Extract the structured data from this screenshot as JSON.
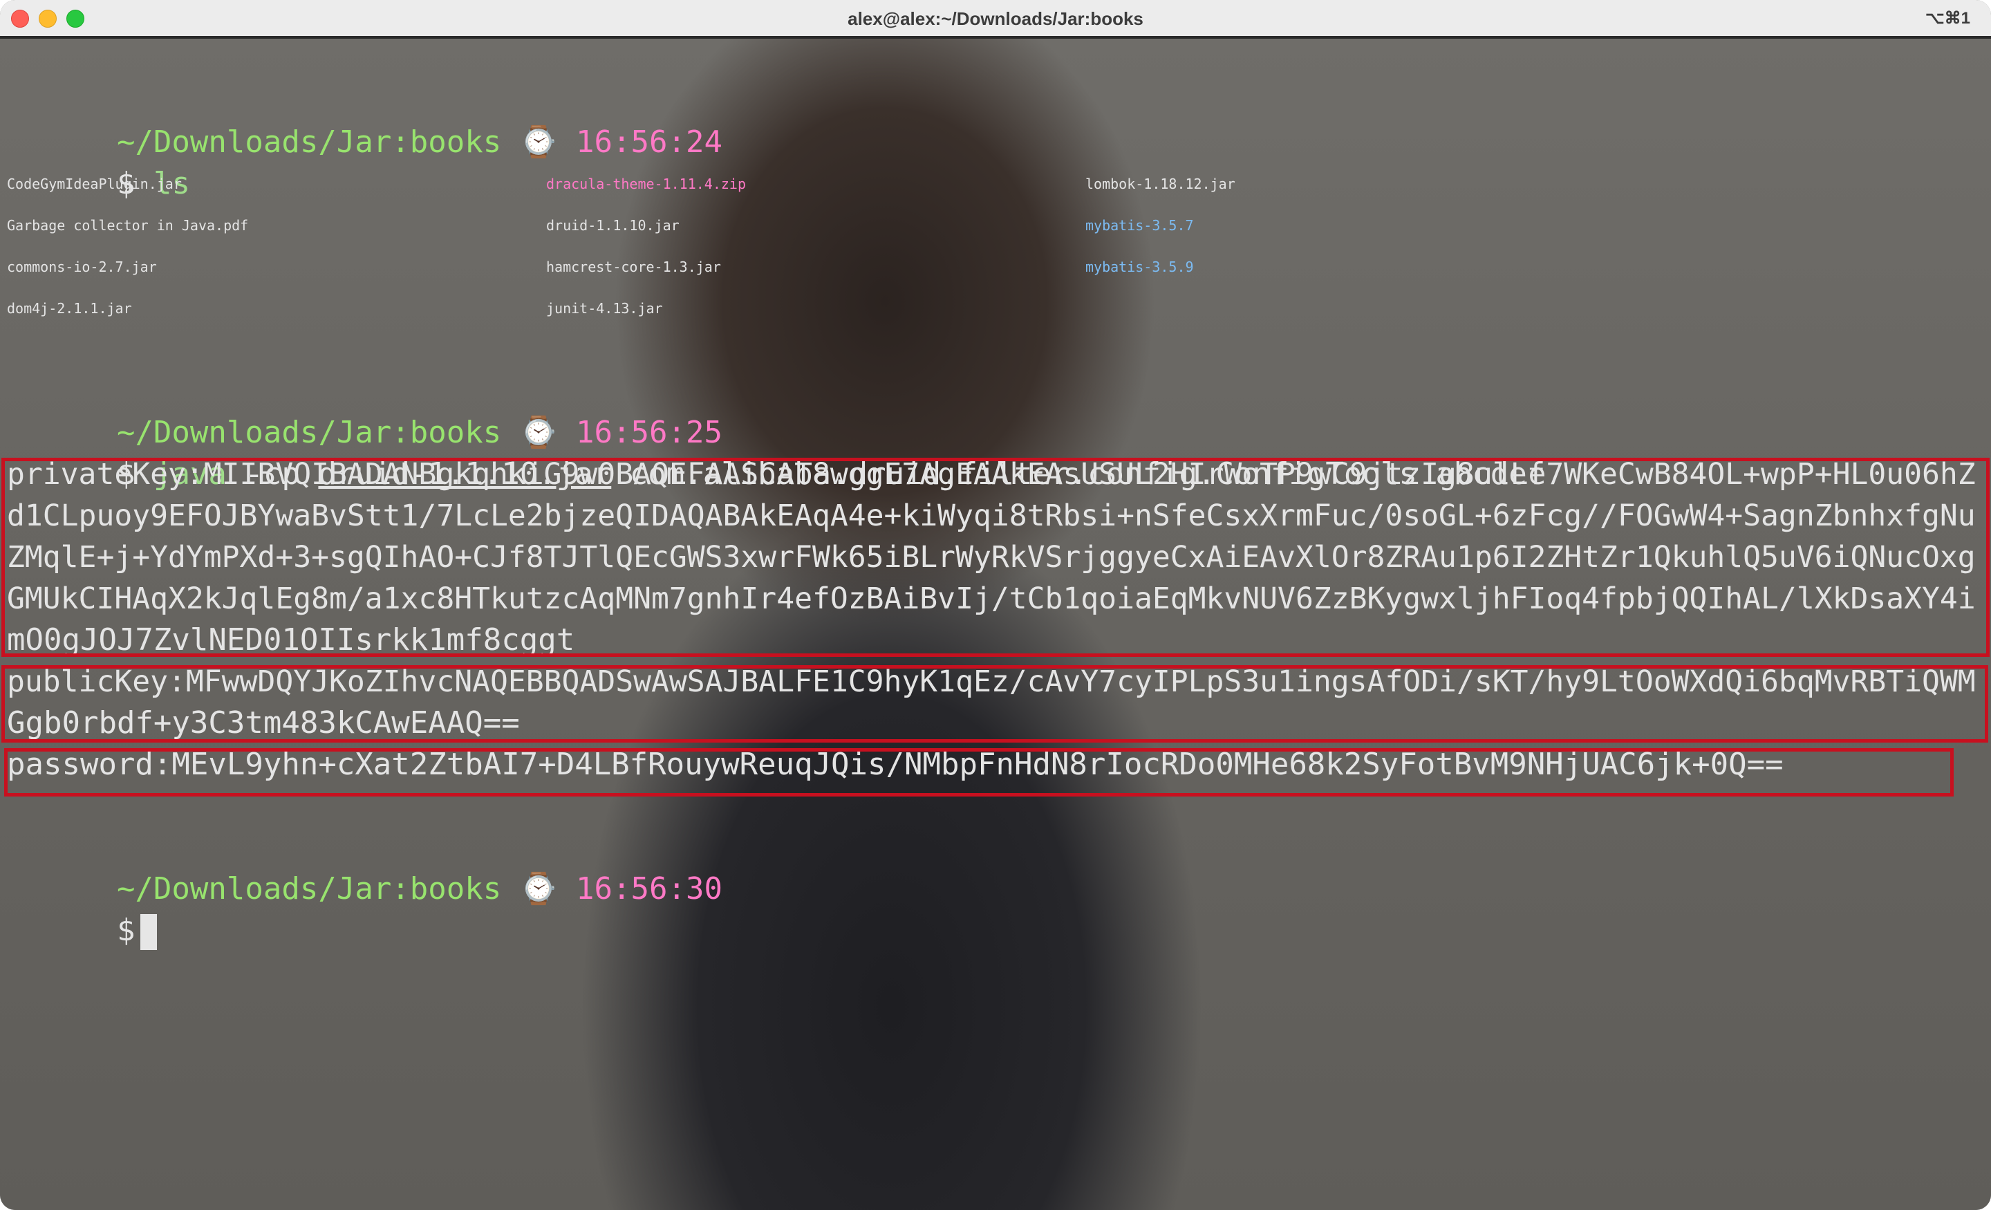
{
  "window": {
    "title": "alex@alex:~/Downloads/Jar:books",
    "shortcut": "⌥⌘1"
  },
  "prompts": [
    {
      "path": "~/Downloads/Jar:books",
      "icon": "⌚",
      "time": "16:56:24",
      "symbol": "$",
      "command": "ls"
    },
    {
      "path": "~/Downloads/Jar:books",
      "icon": "⌚",
      "time": "16:56:25",
      "symbol": "$",
      "command_name": "java",
      "command_flag": "-cp",
      "command_arg_jar": "druid-1.1.10.jar",
      "command_rest": "com.alibaba.druid.filter.config.ConfigTools abcdef"
    },
    {
      "path": "~/Downloads/Jar:books",
      "icon": "⌚",
      "time": "16:56:30",
      "symbol": "$"
    }
  ],
  "ls_output": {
    "rows": [
      [
        "CodeGymIdeaPlugin.jar",
        "dracula-theme-1.11.4.zip",
        "lombok-1.18.12.jar"
      ],
      [
        "Garbage collector in Java.pdf",
        "druid-1.1.10.jar",
        "mybatis-3.5.7"
      ],
      [
        "commons-io-2.7.jar",
        "hamcrest-core-1.3.jar",
        "mybatis-3.5.9"
      ],
      [
        "dom4j-2.1.1.jar",
        "junit-4.13.jar",
        ""
      ]
    ],
    "colors": {
      "archive": "#ff79c6",
      "directory": "#7cbbf2",
      "file": "#e4e4e4"
    }
  },
  "output": {
    "private_key_lines": [
      "privateKey:MIIBVQIBADANBgkqhkiG9w0BAQEFAASCAT8wggE7AgEAAkEAsUSUL2HIrWoTP9wC9jtzIg8ulLe7WKeCwB84OL+wpP+HL0u06hZ",
      "d1CLpuoy9EFOJBYwaBvStt1/7LcLe2bjzeQIDAQABAkEAqA4e+kiWyqi8tRbsi+nSfeCsxXrmFuc/0soGL+6zFcg//FOGwW4+SagnZbnhxfgNu",
      "ZMqlE+j+YdYmPXd+3+sgQIhAO+CJf8TJTlQEcGWS3xwrFWk65iBLrWyRkVSrjggyeCxAiEAvXlOr8ZRAu1p6I2ZHtZr1QkuhlQ5uV6iQNucOxg",
      "GMUkCIHAqX2kJqlEg8m/a1xc8HTkutzcAqMNm7gnhIr4efOzBAiBvIj/tCb1qoiaEqMkvNUV6ZzBKygwxljhFIoq4fpbjQQIhAL/lXkDsaXY4i",
      "mO0gJOJ7ZvlNED01OIIsrkk1mf8cggt"
    ],
    "public_key_lines": [
      "publicKey:MFwwDQYJKoZIhvcNAQEBBQADSwAwSAJBALFE1C9hyK1qEz/cAvY7cyIPLpS3u1ingsAfODi/sKT/hy9LtOoWXdQi6bqMvRBTiQWM",
      "Ggb0rbdf+y3C3tm483kCAwEAAQ=="
    ],
    "password_line": "password:MEvL9yhn+cXat2ZtbAI7+D4LBfRouywReuqJQis/NMbpFnHdN8rIocRDo0MHe68k2SyFotBvM9NHjUAC6jk+0Q=="
  },
  "colors": {
    "prompt_path": "#98e36e",
    "prompt_time": "#ff79c6",
    "highlight_box": "#c8101f"
  }
}
